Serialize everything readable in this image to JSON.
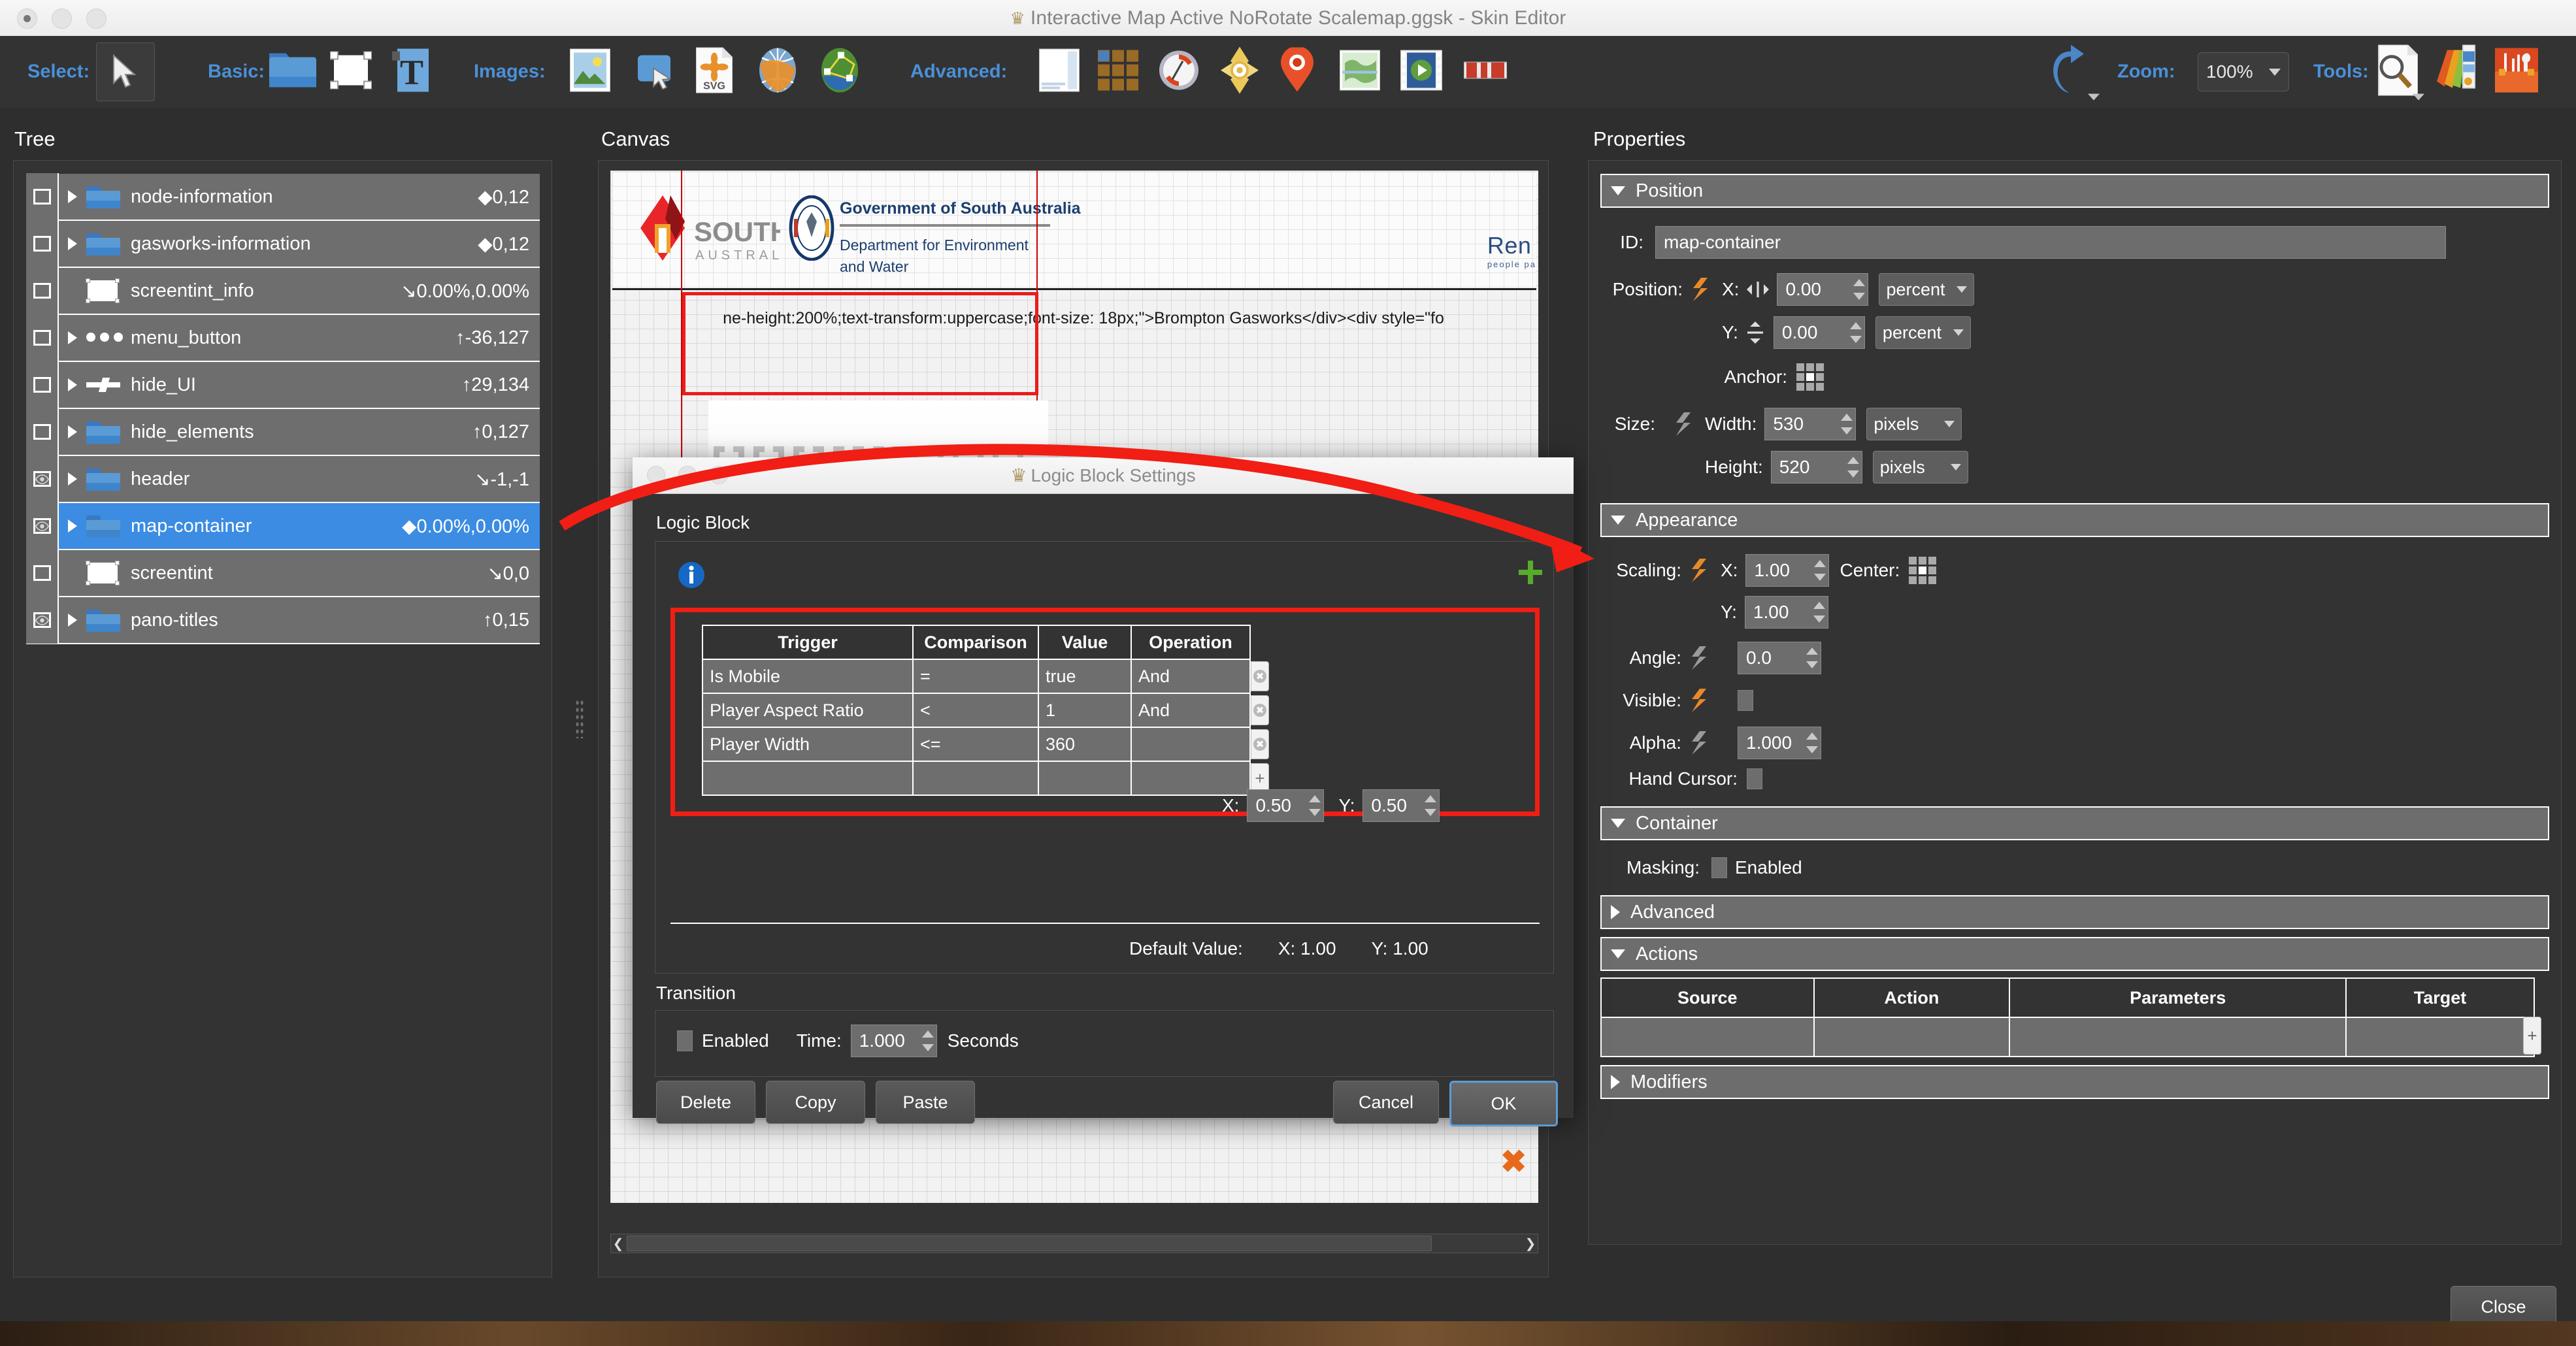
{
  "window": {
    "title": "Interactive Map Active NoRotate Scalemap.ggsk - Skin Editor"
  },
  "toolbar": {
    "groups": [
      {
        "label": "Select:",
        "items": [
          {
            "name": "pointer-tool",
            "icon": "cursor-icon"
          }
        ]
      },
      {
        "label": "Basic:",
        "items": [
          {
            "name": "container-tool",
            "icon": "folder-icon"
          },
          {
            "name": "rectangle-tool",
            "icon": "rectangle-icon"
          },
          {
            "name": "text-tool",
            "icon": "text-icon"
          }
        ]
      },
      {
        "label": "Images:",
        "items": [
          {
            "name": "image-tool",
            "icon": "image-icon"
          },
          {
            "name": "button-tool",
            "icon": "button-icon"
          },
          {
            "name": "svg-tool",
            "icon": "svg-file-icon"
          },
          {
            "name": "hotspot-tool",
            "icon": "globe-orange-icon"
          },
          {
            "name": "polygon-hotspot-tool",
            "icon": "globe-green-icon"
          }
        ]
      },
      {
        "label": "Advanced:",
        "items": [
          {
            "name": "popup-tool",
            "icon": "popup-panel-icon"
          },
          {
            "name": "thumbnail-list-tool",
            "icon": "grid-thumbs-icon"
          },
          {
            "name": "compass-tool",
            "icon": "compass-icon"
          },
          {
            "name": "radar-tool",
            "icon": "radar-icon"
          },
          {
            "name": "map-marker-tool",
            "icon": "map-pin-icon"
          },
          {
            "name": "map-tool",
            "icon": "world-map-icon"
          },
          {
            "name": "video-tool",
            "icon": "video-player-icon"
          },
          {
            "name": "timeline-tool",
            "icon": "timeline-icon"
          }
        ]
      }
    ],
    "undo_label": "undo-icon",
    "zoom_label": "Zoom:",
    "zoom_value": "100%",
    "tools_label": "Tools:",
    "tools": [
      {
        "name": "inspect-tool",
        "icon": "magnifier-page-icon"
      },
      {
        "name": "color-picker-tool",
        "icon": "color-swatches-icon"
      },
      {
        "name": "toolbox-tool",
        "icon": "toolbox-icon"
      }
    ]
  },
  "tree": {
    "title": "Tree",
    "rows": [
      {
        "visible": false,
        "expandable": true,
        "icon": "folder-icon",
        "name": "node-information",
        "value": "◆0,12"
      },
      {
        "visible": false,
        "expandable": true,
        "icon": "folder-icon",
        "name": "gasworks-information",
        "value": "◆0,12"
      },
      {
        "visible": false,
        "expandable": false,
        "icon": "rectangle-icon",
        "name": "screentint_info",
        "value": "↘0.00%,0.00%"
      },
      {
        "visible": false,
        "expandable": true,
        "icon": "dots-icon",
        "name": "menu_button",
        "value": "↑-36,127"
      },
      {
        "visible": false,
        "expandable": true,
        "icon": "slider-icon",
        "name": "hide_UI",
        "value": "↑29,134"
      },
      {
        "visible": false,
        "expandable": true,
        "icon": "folder-icon",
        "name": "hide_elements",
        "value": "↑0,127"
      },
      {
        "visible": true,
        "expandable": true,
        "icon": "folder-icon",
        "name": "header",
        "value": "↘-1,-1"
      },
      {
        "visible": true,
        "expandable": true,
        "icon": "folder-icon",
        "name": "map-container",
        "value": "◆0.00%,0.00%",
        "selected": true
      },
      {
        "visible": false,
        "expandable": false,
        "icon": "rectangle-icon",
        "name": "screentint",
        "value": "↘0,0"
      },
      {
        "visible": true,
        "expandable": true,
        "icon": "folder-icon",
        "name": "pano-titles",
        "value": "↑0,15"
      }
    ]
  },
  "canvas": {
    "title": "Canvas",
    "logo_primary": "SOUTH",
    "logo_secondary": "AUSTRALIA",
    "gov_line1": "Government of South Australia",
    "gov_line2": "Department for Environment",
    "gov_line3": "and Water",
    "renewal_text": "Ren",
    "renewal_sub": "people  pa",
    "code_snippet": "ne-height:200%;text-transform:uppercase;font-size: 18px;\">Brompton Gasworks</div><div style=\"fo"
  },
  "properties": {
    "title": "Properties",
    "sections": {
      "position": {
        "label": "Position",
        "id_label": "ID:",
        "id_value": "map-container",
        "position_label": "Position:",
        "x_label": "X:",
        "x_value": "0.00",
        "x_unit": "percent",
        "y_label": "Y:",
        "y_value": "0.00",
        "y_unit": "percent",
        "anchor_label": "Anchor:",
        "size_label": "Size:",
        "width_label": "Width:",
        "width_value": "530",
        "width_unit": "pixels",
        "height_label": "Height:",
        "height_value": "520",
        "height_unit": "pixels"
      },
      "appearance": {
        "label": "Appearance",
        "scaling_label": "Scaling:",
        "scale_x_label": "X:",
        "scale_x_value": "1.00",
        "scale_y_label": "Y:",
        "scale_y_value": "1.00",
        "center_label": "Center:",
        "angle_label": "Angle:",
        "angle_value": "0.0",
        "visible_label": "Visible:",
        "alpha_label": "Alpha:",
        "alpha_value": "1.000",
        "hand_cursor_label": "Hand Cursor:"
      },
      "container": {
        "label": "Container",
        "masking_label": "Masking:",
        "masking_checkbox_label": "Enabled"
      },
      "advanced": {
        "label": "Advanced"
      },
      "actions": {
        "label": "Actions",
        "columns": [
          "Source",
          "Action",
          "Parameters",
          "Target"
        ],
        "rows": [
          [
            "",
            "",
            "",
            ""
          ]
        ],
        "add_label": "+"
      },
      "modifiers": {
        "label": "Modifiers"
      }
    },
    "close_label": "Close"
  },
  "dialog": {
    "title": "Logic Block Settings",
    "group_label": "Logic Block",
    "info_icon": "info-icon",
    "add_icon": "add-green-plus-icon",
    "remove_icon": "remove-orange-x-icon",
    "table": {
      "columns": [
        "Trigger",
        "Comparison",
        "Value",
        "Operation"
      ],
      "rows": [
        {
          "trigger": "Is Mobile",
          "comparison": "=",
          "value": "true",
          "operation": "And"
        },
        {
          "trigger": "Player Aspect Ratio",
          "comparison": "<",
          "value": "1",
          "operation": "And"
        },
        {
          "trigger": "Player Width",
          "comparison": "<=",
          "value": "360",
          "operation": ""
        }
      ]
    },
    "block_x_label": "X:",
    "block_x_value": "0.50",
    "block_y_label": "Y:",
    "block_y_value": "0.50",
    "default_value_label": "Default Value:",
    "default_x_label": "X: 1.00",
    "default_y_label": "Y: 1.00",
    "transition_label": "Transition",
    "transition_enabled_label": "Enabled",
    "transition_time_label": "Time:",
    "transition_time_value": "1.000",
    "transition_seconds_label": "Seconds",
    "buttons": {
      "delete": "Delete",
      "copy": "Copy",
      "paste": "Paste",
      "cancel": "Cancel",
      "ok": "OK"
    }
  },
  "colors": {
    "accent_blue": "#4a90d9",
    "selection_blue": "#3b8ce2",
    "annotation_red": "#f01e14",
    "panel_bg": "#333333",
    "field_bg": "#6d6d6d"
  }
}
